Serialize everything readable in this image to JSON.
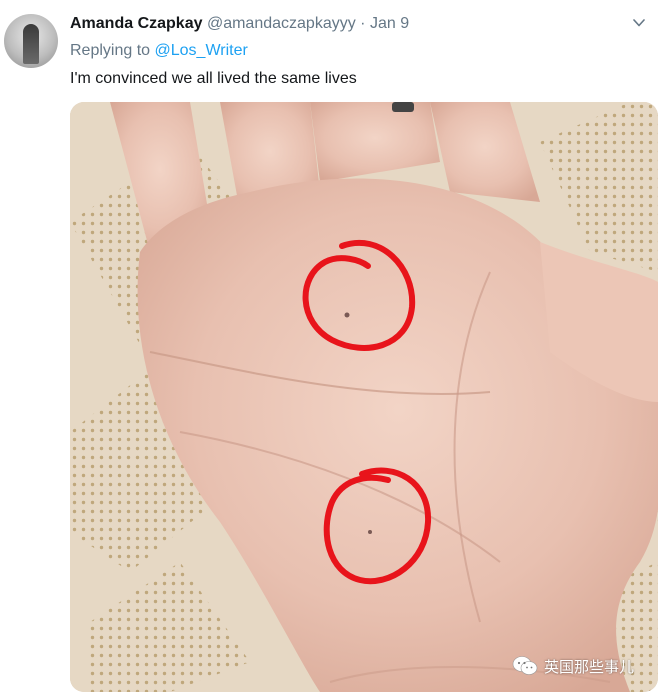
{
  "tweet": {
    "author_name": "Amanda Czapkay",
    "author_handle": "@amandaczapkayyy",
    "separator": "·",
    "date": "Jan 9",
    "replying_to_label": "Replying to",
    "replying_to_handle": "@Los_Writer",
    "text": "I'm convinced we all lived the same lives"
  },
  "watermark": {
    "text": "英国那些事儿"
  },
  "icons": {
    "avatar": "avatar",
    "more": "chevron-down-icon",
    "photo": "photo",
    "watermark_logo": "wechat-icon"
  },
  "colors": {
    "text_primary": "#14171a",
    "text_secondary": "#657786",
    "link": "#1da1f2",
    "annotation": "#e8141b"
  }
}
